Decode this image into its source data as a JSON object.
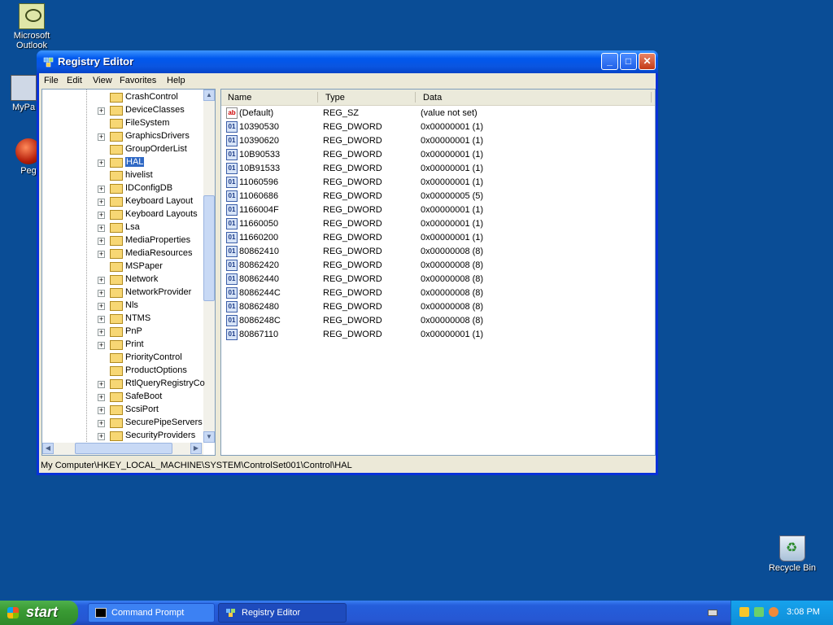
{
  "desktop": {
    "icons": [
      {
        "label": "Microsoft Outlook"
      },
      {
        "label": "MyPa"
      },
      {
        "label": "Peg"
      },
      {
        "label": "Recycle Bin"
      }
    ]
  },
  "window": {
    "title": "Registry Editor",
    "buttons": {
      "minimize": "_",
      "maximize": "□",
      "close": "✕"
    },
    "menu": [
      "File",
      "Edit",
      "View",
      "Favorites",
      "Help"
    ],
    "tree": [
      {
        "label": "CrashControl",
        "expandable": false
      },
      {
        "label": "DeviceClasses",
        "expandable": true
      },
      {
        "label": "FileSystem",
        "expandable": false
      },
      {
        "label": "GraphicsDrivers",
        "expandable": true
      },
      {
        "label": "GroupOrderList",
        "expandable": false
      },
      {
        "label": "HAL",
        "expandable": true,
        "selected": true
      },
      {
        "label": "hivelist",
        "expandable": false
      },
      {
        "label": "IDConfigDB",
        "expandable": true
      },
      {
        "label": "Keyboard Layout",
        "expandable": true
      },
      {
        "label": "Keyboard Layouts",
        "expandable": true
      },
      {
        "label": "Lsa",
        "expandable": true
      },
      {
        "label": "MediaProperties",
        "expandable": true
      },
      {
        "label": "MediaResources",
        "expandable": true
      },
      {
        "label": "MSPaper",
        "expandable": false
      },
      {
        "label": "Network",
        "expandable": true
      },
      {
        "label": "NetworkProvider",
        "expandable": true
      },
      {
        "label": "Nls",
        "expandable": true
      },
      {
        "label": "NTMS",
        "expandable": true
      },
      {
        "label": "PnP",
        "expandable": true
      },
      {
        "label": "Print",
        "expandable": true
      },
      {
        "label": "PriorityControl",
        "expandable": false
      },
      {
        "label": "ProductOptions",
        "expandable": false
      },
      {
        "label": "RtlQueryRegistryCo",
        "expandable": true
      },
      {
        "label": "SafeBoot",
        "expandable": true
      },
      {
        "label": "ScsiPort",
        "expandable": true
      },
      {
        "label": "SecurePipeServers",
        "expandable": true
      },
      {
        "label": "SecurityProviders",
        "expandable": true
      }
    ],
    "columns": {
      "name": "Name",
      "type": "Type",
      "data": "Data"
    },
    "values": [
      {
        "name": "(Default)",
        "type": "REG_SZ",
        "data": "(value not set)",
        "kind": "string"
      },
      {
        "name": "10390530",
        "type": "REG_DWORD",
        "data": "0x00000001 (1)",
        "kind": "binary"
      },
      {
        "name": "10390620",
        "type": "REG_DWORD",
        "data": "0x00000001 (1)",
        "kind": "binary"
      },
      {
        "name": "10B90533",
        "type": "REG_DWORD",
        "data": "0x00000001 (1)",
        "kind": "binary"
      },
      {
        "name": "10B91533",
        "type": "REG_DWORD",
        "data": "0x00000001 (1)",
        "kind": "binary"
      },
      {
        "name": "11060596",
        "type": "REG_DWORD",
        "data": "0x00000001 (1)",
        "kind": "binary"
      },
      {
        "name": "11060686",
        "type": "REG_DWORD",
        "data": "0x00000005 (5)",
        "kind": "binary"
      },
      {
        "name": "1166004F",
        "type": "REG_DWORD",
        "data": "0x00000001 (1)",
        "kind": "binary"
      },
      {
        "name": "11660050",
        "type": "REG_DWORD",
        "data": "0x00000001 (1)",
        "kind": "binary"
      },
      {
        "name": "11660200",
        "type": "REG_DWORD",
        "data": "0x00000001 (1)",
        "kind": "binary"
      },
      {
        "name": "80862410",
        "type": "REG_DWORD",
        "data": "0x00000008 (8)",
        "kind": "binary"
      },
      {
        "name": "80862420",
        "type": "REG_DWORD",
        "data": "0x00000008 (8)",
        "kind": "binary"
      },
      {
        "name": "80862440",
        "type": "REG_DWORD",
        "data": "0x00000008 (8)",
        "kind": "binary"
      },
      {
        "name": "8086244C",
        "type": "REG_DWORD",
        "data": "0x00000008 (8)",
        "kind": "binary"
      },
      {
        "name": "80862480",
        "type": "REG_DWORD",
        "data": "0x00000008 (8)",
        "kind": "binary"
      },
      {
        "name": "8086248C",
        "type": "REG_DWORD",
        "data": "0x00000008 (8)",
        "kind": "binary"
      },
      {
        "name": "80867110",
        "type": "REG_DWORD",
        "data": "0x00000001 (1)",
        "kind": "binary"
      }
    ],
    "status": "My Computer\\HKEY_LOCAL_MACHINE\\SYSTEM\\ControlSet001\\Control\\HAL"
  },
  "taskbar": {
    "start_label": "start",
    "tasks": [
      {
        "label": "Command Prompt",
        "active": false
      },
      {
        "label": "Registry Editor",
        "active": true
      }
    ],
    "clock": "3:08 PM"
  },
  "colors": {
    "desktop": "#0a4d96",
    "selection": "#316ac5",
    "titlebar": "#0058ee"
  }
}
